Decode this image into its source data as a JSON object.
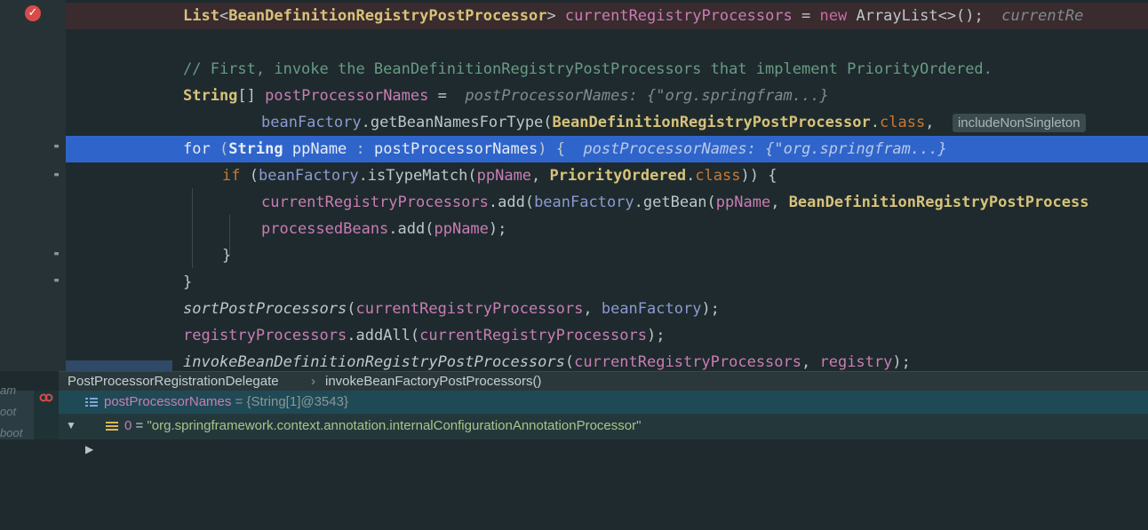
{
  "editor": {
    "lines": [
      {
        "t1": "List",
        "t2": "<",
        "t3": "BeanDefinitionRegistryPostProcessor",
        "t4": "> ",
        "t5": "currentRegistryProcessors",
        "t6": " = ",
        "t7": "new",
        "t8": " ArrayList<>();  ",
        "t9": "currentRe"
      },
      {
        "comment": "// First, invoke the BeanDefinitionRegistryPostProcessors that implement PriorityOrdered."
      },
      {
        "t1": "String",
        "t2": "[] ",
        "t3": "postProcessorNames",
        "t4": " =  ",
        "hint": "postProcessorNames: {\"org.springfram...}"
      },
      {
        "t1": "beanFactory",
        "t2": ".getBeanNamesForType(",
        "t3": "BeanDefinitionRegistryPostProcessor",
        "t4": ".",
        "t5": "class",
        ",": ",",
        "hintbox": "includeNonSingleton"
      },
      {
        "t1": "for",
        "t2": " (",
        "t3": "String",
        "t4": " ",
        "t5": "ppName",
        "t6": " : ",
        "t7": "postProcessorNames",
        "t8": ") {  ",
        "hint": "postProcessorNames: {\"org.springfram...}"
      },
      {
        "t1": "if",
        "t2": " (",
        "t3": "beanFactory",
        "t4": ".isTypeMatch(",
        "t5": "ppName",
        ",": ", ",
        "t6": "PriorityOrdered",
        "t7": ".",
        "t8": "class",
        "t9": ")) {"
      },
      {
        "t1": "currentRegistryProcessors",
        "t2": ".add(",
        "t3": "beanFactory",
        "t4": ".getBean(",
        "t5": "ppName",
        ",": ", ",
        "t6": "BeanDefinitionRegistryPostProcess"
      },
      {
        "t1": "processedBeans",
        "t2": ".add(",
        "t3": "ppName",
        "t4": ");"
      },
      {
        "t1": "}"
      },
      {
        "t1": "}"
      },
      {
        "t1": "sortPostProcessors",
        "t2": "(",
        "t3": "currentRegistryProcessors",
        ",": ", ",
        "t4": "beanFactory",
        "t5": ");"
      },
      {
        "t1": "registryProcessors",
        "t2": ".addAll(",
        "t3": "currentRegistryProcessors",
        "t4": ");"
      },
      {
        "t1": "invokeBeanDefinitionRegistryPostProcessors",
        "t2": "(",
        "t3": "currentRegistryProcessors",
        ",": ", ",
        "t4": "registry",
        "t5": ");"
      }
    ]
  },
  "breadcrumb": {
    "class_name": "PostProcessorRegistrationDelegate",
    "separator": "›",
    "method_name": "invokeBeanFactoryPostProcessors()"
  },
  "side_labels": [
    "am",
    "oot",
    "boot"
  ],
  "debug": {
    "var_name": "postProcessorNames",
    "var_type": " = {String[1]@3543}",
    "child_index": "0",
    "child_eq": " = ",
    "child_value": "\"org.springframework.context.annotation.internalConfigurationAnnotationProcessor\""
  },
  "icons": {
    "breakpoint": "breakpoint-check-icon",
    "fold": "fold-marker-icon",
    "expand": "triangle-icon",
    "array": "array-icon",
    "field": "field-icon"
  },
  "colors": {
    "current_line": "#2f65ca",
    "breakpoint_line": "#3a2b2e",
    "breakpoint": "#d94a4a"
  }
}
